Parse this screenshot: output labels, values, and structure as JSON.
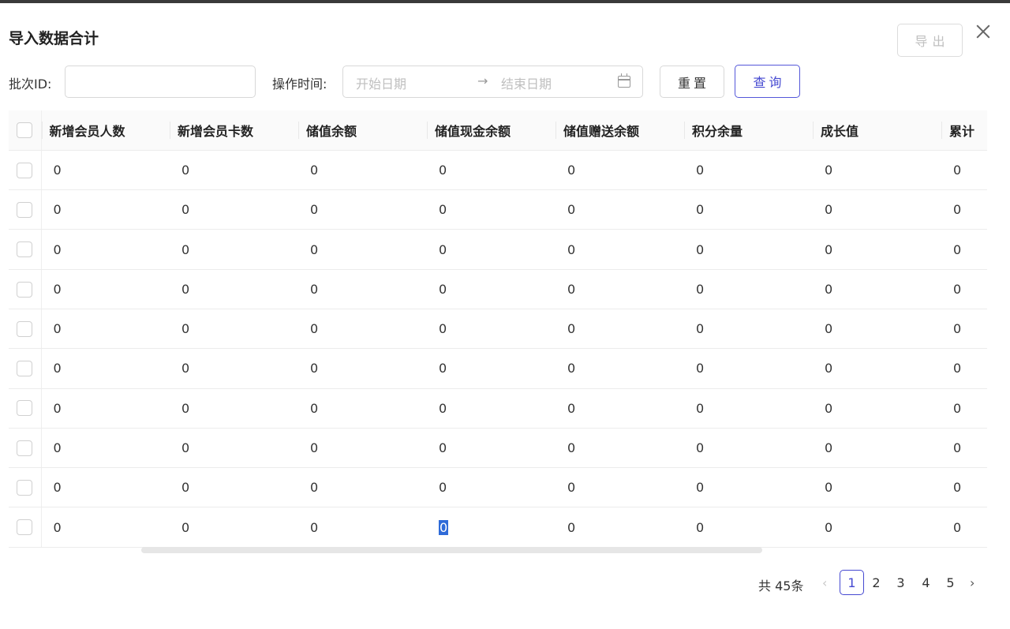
{
  "dialog": {
    "title": "导入数据合计",
    "export_label": "导出"
  },
  "filters": {
    "batch_label": "批次ID:",
    "batch_value": "",
    "time_label": "操作时间:",
    "start_placeholder": "开始日期",
    "separator": "→",
    "end_placeholder": "结束日期",
    "reset_label": "重置",
    "query_label": "查询"
  },
  "table": {
    "columns": [
      "新增会员人数",
      "新增会员卡数",
      "储值余额",
      "储值现金余额",
      "储值赠送余额",
      "积分余量",
      "成长值",
      "累计"
    ],
    "rows": [
      [
        "0",
        "0",
        "0",
        "0",
        "0",
        "0",
        "0",
        "0"
      ],
      [
        "0",
        "0",
        "0",
        "0",
        "0",
        "0",
        "0",
        "0"
      ],
      [
        "0",
        "0",
        "0",
        "0",
        "0",
        "0",
        "0",
        "0"
      ],
      [
        "0",
        "0",
        "0",
        "0",
        "0",
        "0",
        "0",
        "0"
      ],
      [
        "0",
        "0",
        "0",
        "0",
        "0",
        "0",
        "0",
        "0"
      ],
      [
        "0",
        "0",
        "0",
        "0",
        "0",
        "0",
        "0",
        "0"
      ],
      [
        "0",
        "0",
        "0",
        "0",
        "0",
        "0",
        "0",
        "0"
      ],
      [
        "0",
        "0",
        "0",
        "0",
        "0",
        "0",
        "0",
        "0"
      ],
      [
        "0",
        "0",
        "0",
        "0",
        "0",
        "0",
        "0",
        "0"
      ],
      [
        "0",
        "0",
        "0",
        "0",
        "0",
        "0",
        "0",
        "0"
      ]
    ],
    "selected_cell": [
      9,
      3
    ]
  },
  "pagination": {
    "total_text": "共 45条",
    "prev_icon": "chevron-left-icon",
    "next_icon": "chevron-right-icon",
    "pages": [
      "1",
      "2",
      "3",
      "4",
      "5"
    ],
    "current": "1"
  }
}
